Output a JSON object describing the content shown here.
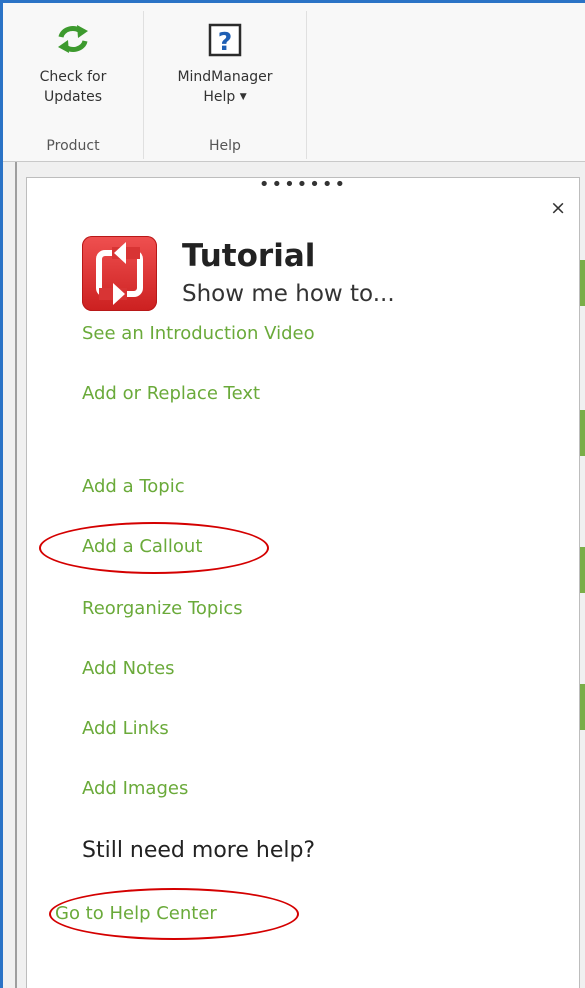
{
  "ribbon": {
    "product_group": {
      "label": "Product",
      "check_updates": {
        "line1": "Check for",
        "line2": "Updates",
        "icon": "refresh-icon"
      }
    },
    "help_group": {
      "label": "Help",
      "mindmanager_help": {
        "line1": "MindManager",
        "line2": "Help",
        "icon": "question-icon"
      }
    }
  },
  "panel": {
    "title": "Tutorial",
    "subtitle": "Show me how to...",
    "links": [
      "See an Introduction Video",
      "Add or Replace Text",
      "Add a Topic",
      "Add a Callout",
      "Reorganize Topics",
      "Add Notes",
      "Add Links",
      "Add Images"
    ],
    "more_help": "Still need more help?",
    "help_center": "Go to Help Center",
    "close": "×"
  },
  "colors": {
    "accent_border": "#2b73c6",
    "link_green": "#6aaa3a",
    "annotation_red": "#d40000",
    "tutorial_icon_red": "#e03a3a"
  }
}
